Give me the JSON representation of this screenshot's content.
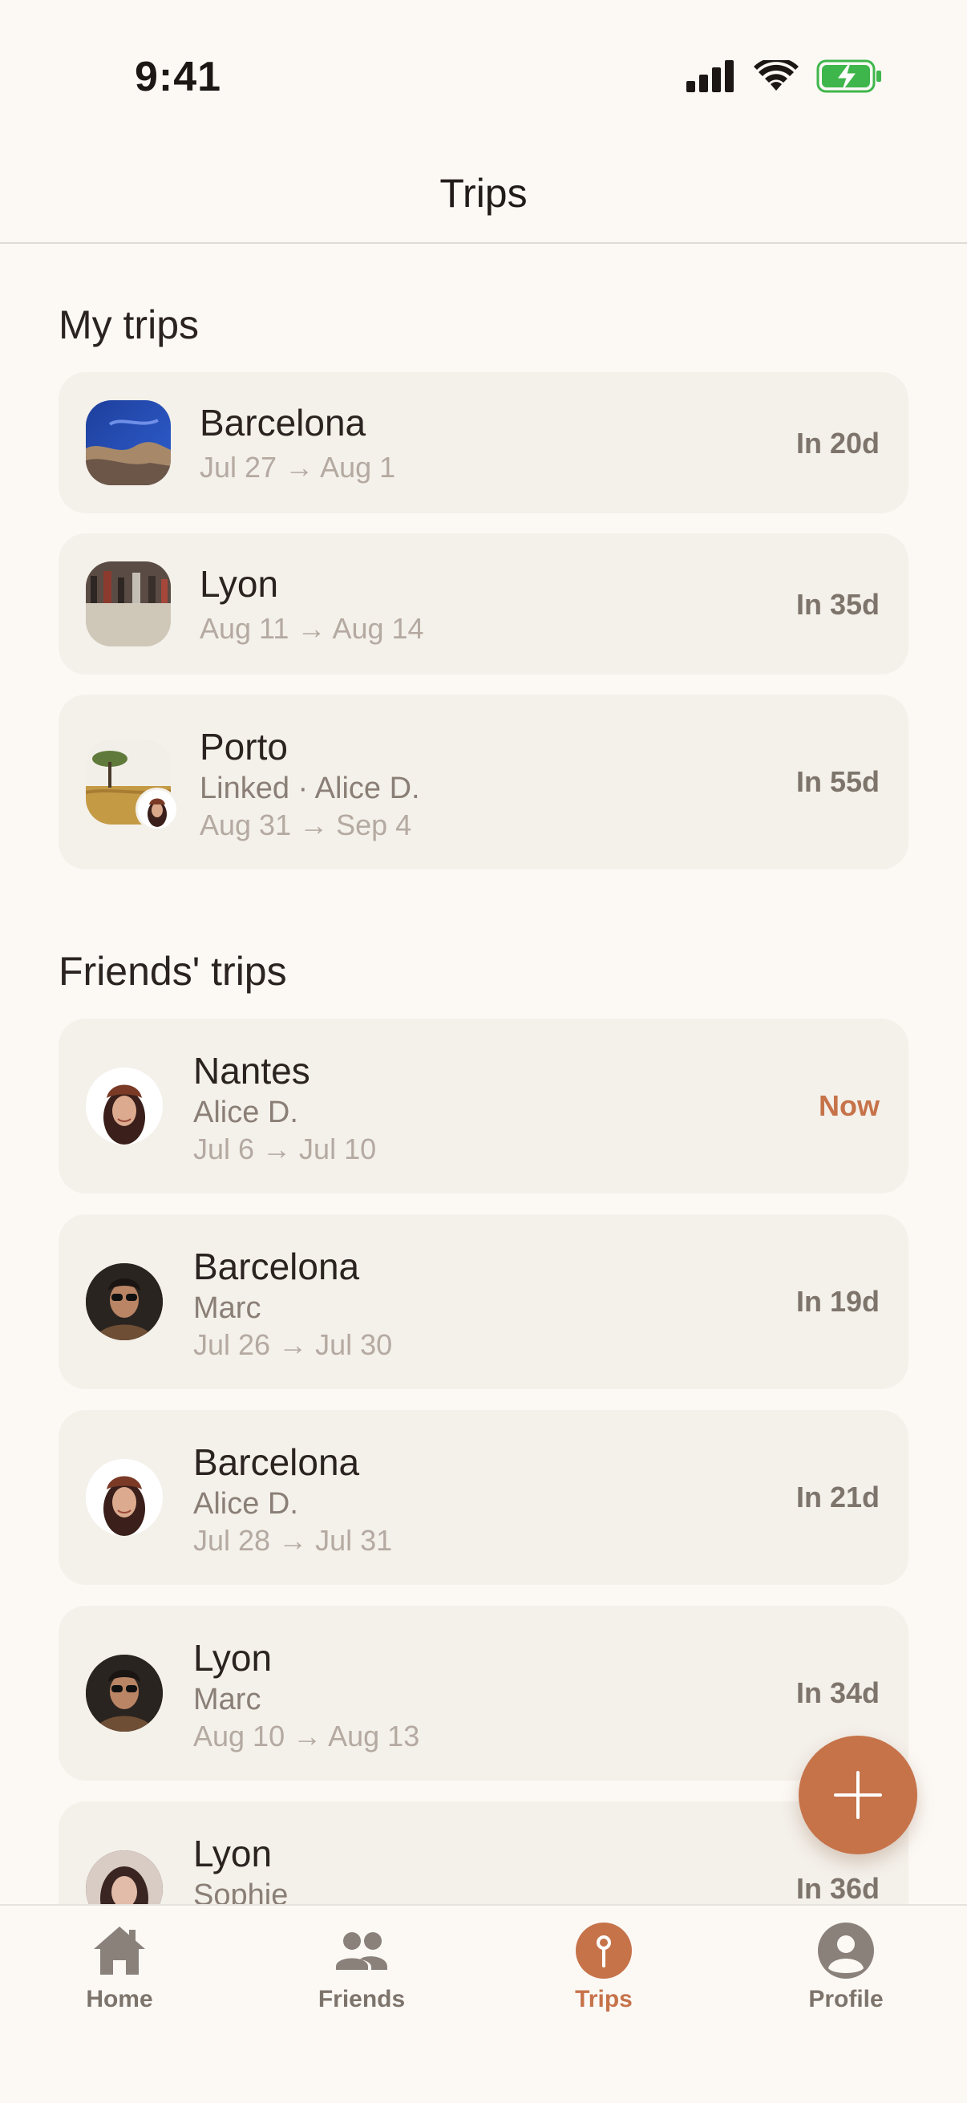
{
  "status_bar": {
    "time": "9:41"
  },
  "header": {
    "title": "Trips"
  },
  "my_trips": {
    "title": "My trips",
    "items": [
      {
        "city": "Barcelona",
        "dates": "Jul 27 → Aug 1",
        "badge": "In 20d"
      },
      {
        "city": "Lyon",
        "dates": "Aug 11 → Aug 14",
        "badge": "In 35d"
      },
      {
        "city": "Porto",
        "linked": "Linked · Alice D.",
        "dates": "Aug 31 → Sep 4",
        "badge": "In 55d"
      }
    ]
  },
  "friends_trips": {
    "title": "Friends' trips",
    "items": [
      {
        "city": "Nantes",
        "person": "Alice D.",
        "dates": "Jul 6 → Jul 10",
        "badge": "Now"
      },
      {
        "city": "Barcelona",
        "person": "Marc",
        "dates": "Jul 26 → Jul 30",
        "badge": "In 19d"
      },
      {
        "city": "Barcelona",
        "person": "Alice D.",
        "dates": "Jul 28 → Jul 31",
        "badge": "In 21d"
      },
      {
        "city": "Lyon",
        "person": "Marc",
        "dates": "Aug 10 → Aug 13",
        "badge": "In 34d"
      },
      {
        "city": "Lyon",
        "person": "Sophie",
        "badge": "In 36d"
      }
    ]
  },
  "fab": {
    "icon": "plus-icon"
  },
  "tab_bar": {
    "tabs": [
      {
        "label": "Home",
        "icon": "home-icon"
      },
      {
        "label": "Friends",
        "icon": "friends-icon"
      },
      {
        "label": "Trips",
        "icon": "pin-icon",
        "active": true
      },
      {
        "label": "Profile",
        "icon": "profile-icon"
      }
    ]
  },
  "colors": {
    "accent": "#c6734a",
    "background": "#fcf9f5",
    "card": "#f4f0ea",
    "battery": "#3fb64c"
  }
}
